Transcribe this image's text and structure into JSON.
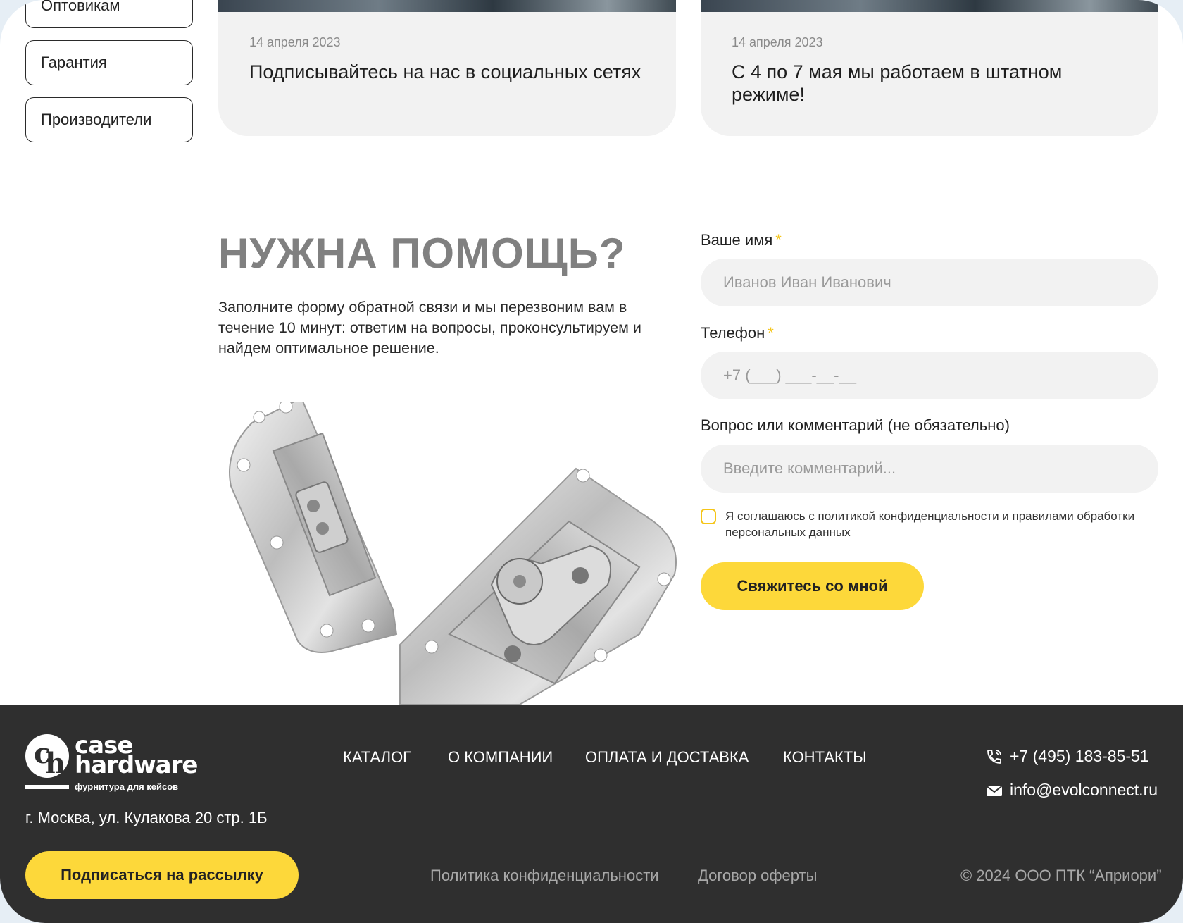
{
  "sidebar": {
    "items": [
      {
        "label": "Оптовикам"
      },
      {
        "label": "Гарантия"
      },
      {
        "label": "Производители"
      }
    ]
  },
  "news": [
    {
      "date": "14 апреля 2023",
      "title": "Подписывайтесь на нас в социальных сетях"
    },
    {
      "date": "14 апреля 2023",
      "title": "С 4 по 7 мая мы работаем в штатном режиме!"
    }
  ],
  "help": {
    "title": "НУЖНА ПОМОЩЬ?",
    "text": "Заполните форму обратной связи и мы перезвоним вам в течение 10 минут: ответим на вопросы, проконсультируем и найдем оптимальное решение."
  },
  "form": {
    "name_label": "Ваше имя",
    "name_placeholder": "Иванов Иван Иванович",
    "phone_label": "Телефон",
    "phone_placeholder": "+7 (___) ___-__-__",
    "comment_label": "Вопрос или комментарий (не обязательно)",
    "comment_placeholder": "Введите комментарий...",
    "required_mark": "*",
    "consent_text": "Я соглашаюсь с политикой конфиденциальности и правилами обработки персональных данных",
    "consent_checked": false,
    "submit_label": "Свяжитесь со мной"
  },
  "footer": {
    "logo": {
      "mark": "ch",
      "line1": "case",
      "line2": "hardware",
      "tagline": "фурнитура для кейсов"
    },
    "address": "г. Москва, ул. Кулакова 20 стр. 1Б",
    "subscribe_label": "Подписаться на рассылку",
    "nav": [
      "КАТАЛОГ",
      "О КОМПАНИИ",
      "ОПЛАТА И ДОСТАВКА",
      "КОНТАКТЫ"
    ],
    "phone": "+7 (495) 183-85-51",
    "email": "info@evolconnect.ru",
    "privacy": "Политика конфиденциальности",
    "offer": "Договор оферты",
    "copyright": "© 2024 ООО ПТК “Априори”"
  },
  "colors": {
    "accent": "#fdd83a",
    "footer_bg": "#2f2f2f",
    "card_bg": "#f2f2f2",
    "title_gray": "#808080"
  }
}
